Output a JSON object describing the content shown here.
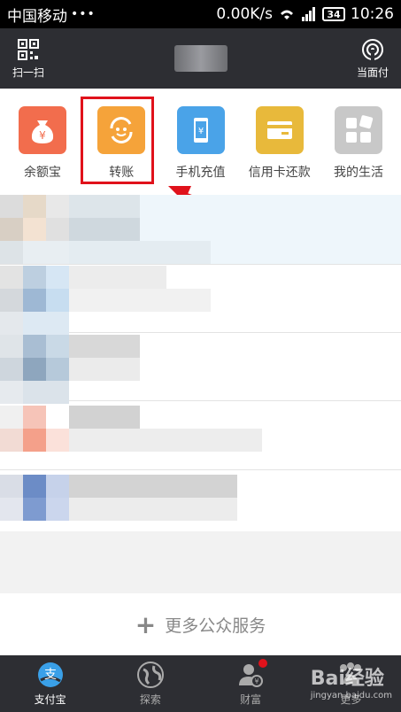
{
  "status_bar": {
    "carrier": "中国移动",
    "dots": "•••",
    "speed": "0.00K/s",
    "battery": "34",
    "time": "10:26"
  },
  "top_bar": {
    "scan_label": "扫一扫",
    "pay_label": "当面付"
  },
  "apps": [
    {
      "label": "余额宝",
      "color": "#f26d4d",
      "icon": "money-bag-icon"
    },
    {
      "label": "转账",
      "color": "#f5a33a",
      "icon": "transfer-icon"
    },
    {
      "label": "手机充值",
      "color": "#4aa3e8",
      "icon": "phone-topup-icon"
    },
    {
      "label": "信用卡还款",
      "color": "#e8b93b",
      "icon": "credit-card-icon"
    },
    {
      "label": "我的生活",
      "color": "#c8c8c8",
      "icon": "grid-icon"
    }
  ],
  "more_services": {
    "label": "更多公众服务"
  },
  "tabs": [
    {
      "label": "支付宝",
      "icon": "alipay-icon",
      "active": true
    },
    {
      "label": "探索",
      "icon": "globe-icon",
      "active": false
    },
    {
      "label": "财富",
      "icon": "wealth-icon",
      "active": false
    },
    {
      "label": "更多",
      "icon": "more-icon",
      "active": false
    }
  ],
  "watermark": {
    "text": "Bai经验",
    "url": "jingyan.baidu.com"
  },
  "colors": {
    "highlight": "#e0121b",
    "topbar": "#2d2e33"
  }
}
